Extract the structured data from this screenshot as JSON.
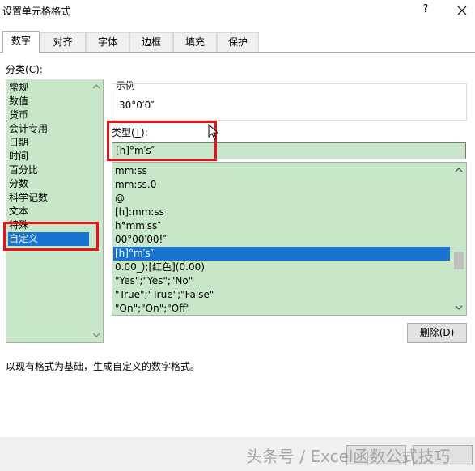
{
  "window": {
    "title": "设置单元格格式",
    "help": "?"
  },
  "tabs": [
    "数字",
    "对齐",
    "字体",
    "边框",
    "填充",
    "保护"
  ],
  "category": {
    "label_prefix": "分类(",
    "label_key": "C",
    "label_suffix": "):",
    "items": [
      "常规",
      "数值",
      "货币",
      "会计专用",
      "日期",
      "时间",
      "百分比",
      "分数",
      "科学记数",
      "文本",
      "特殊",
      "自定义"
    ],
    "selected": "自定义"
  },
  "sample": {
    "label": "示例",
    "value": "30°0′0″"
  },
  "type": {
    "label_prefix": "类型(",
    "label_key": "T",
    "label_suffix": "):",
    "value": "[h]°m′s″"
  },
  "formats": {
    "items": [
      "mm:ss",
      "mm:ss.0",
      "@",
      "[h]:mm:ss",
      "h°mm′ss″",
      "00°00′00!″",
      "[h]°m′s″",
      "0.00_);[红色](0.00)",
      "\"Yes\";\"Yes\";\"No\"",
      "\"True\";\"True\";\"False\"",
      "\"On\";\"On\";\"Off\""
    ],
    "selected": "[h]°m′s″"
  },
  "delete_button": {
    "prefix": "删除(",
    "key": "D",
    "suffix": ")"
  },
  "description": "以现有格式为基础，生成自定义的数字格式。",
  "watermark": "头条号 / Excel函数公式技巧",
  "colors": {
    "list_bg": "#c8e6c8",
    "selection": "#1874d0",
    "highlight": "#e8121a"
  }
}
